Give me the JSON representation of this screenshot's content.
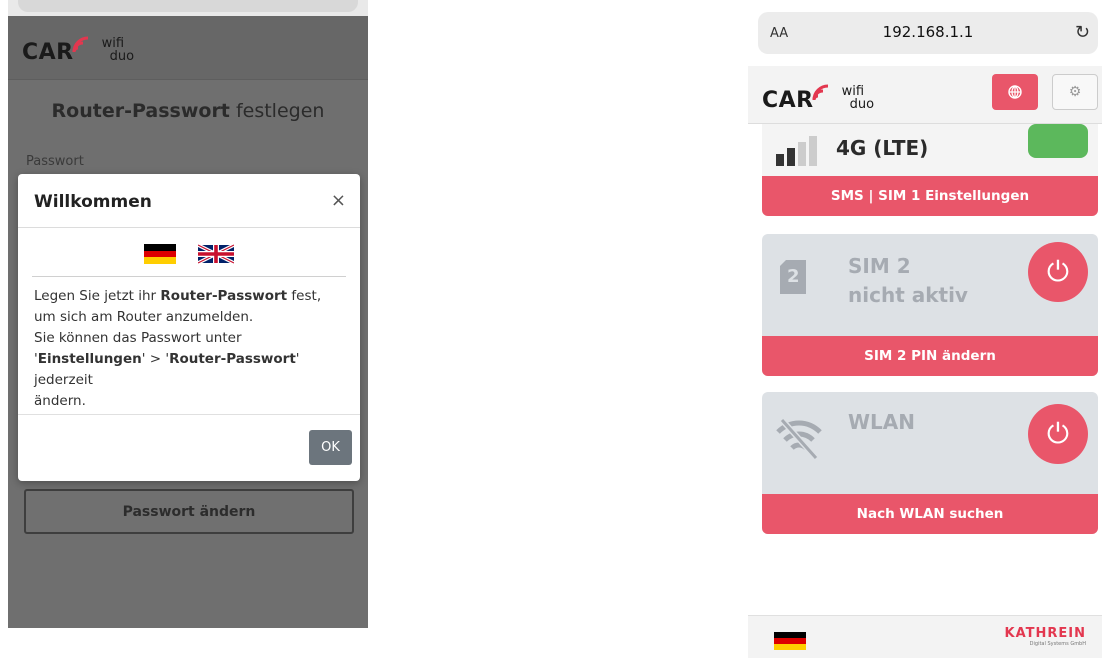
{
  "brand": {
    "car": "CAR",
    "wifi": "wifi",
    "duo": "duo",
    "accent": "#e9566a",
    "car_red": "#e3374f"
  },
  "left": {
    "page_title_bold": "Router-Passwort",
    "page_title_rest": " festlegen",
    "password_label": "Passwort",
    "change_button": "Passwort ändern",
    "modal": {
      "title": "Willkommen",
      "close": "×",
      "body_p1a": "Legen Sie jetzt ihr ",
      "body_p1b": "Router-Passwort",
      "body_p1c": " fest,",
      "body_p2": "um sich am Router anzumelden.",
      "body_p3": "Sie können das Passwort unter",
      "body_p4a": "'",
      "body_p4b": "Einstellungen",
      "body_p4c": "' > '",
      "body_p4d": "Router-Passwort",
      "body_p4e": "' jederzeit",
      "body_p5": "ändern.",
      "ok": "OK"
    }
  },
  "right": {
    "address_aa": "AA",
    "url": "192.168.1.1",
    "reload_icon": "↻",
    "cards": [
      {
        "title": "4G (LTE)",
        "footer": "SMS | SIM 1 Einstellungen"
      },
      {
        "title_line1": "SIM 2",
        "title_line2": "nicht aktiv",
        "sim_number": "2",
        "footer": "SIM 2 PIN ändern"
      },
      {
        "title": "WLAN",
        "footer": "Nach WLAN suchen"
      }
    ],
    "footer_brand": "KATHREIN",
    "footer_brand_sub": "Digital Systems GmbH"
  }
}
